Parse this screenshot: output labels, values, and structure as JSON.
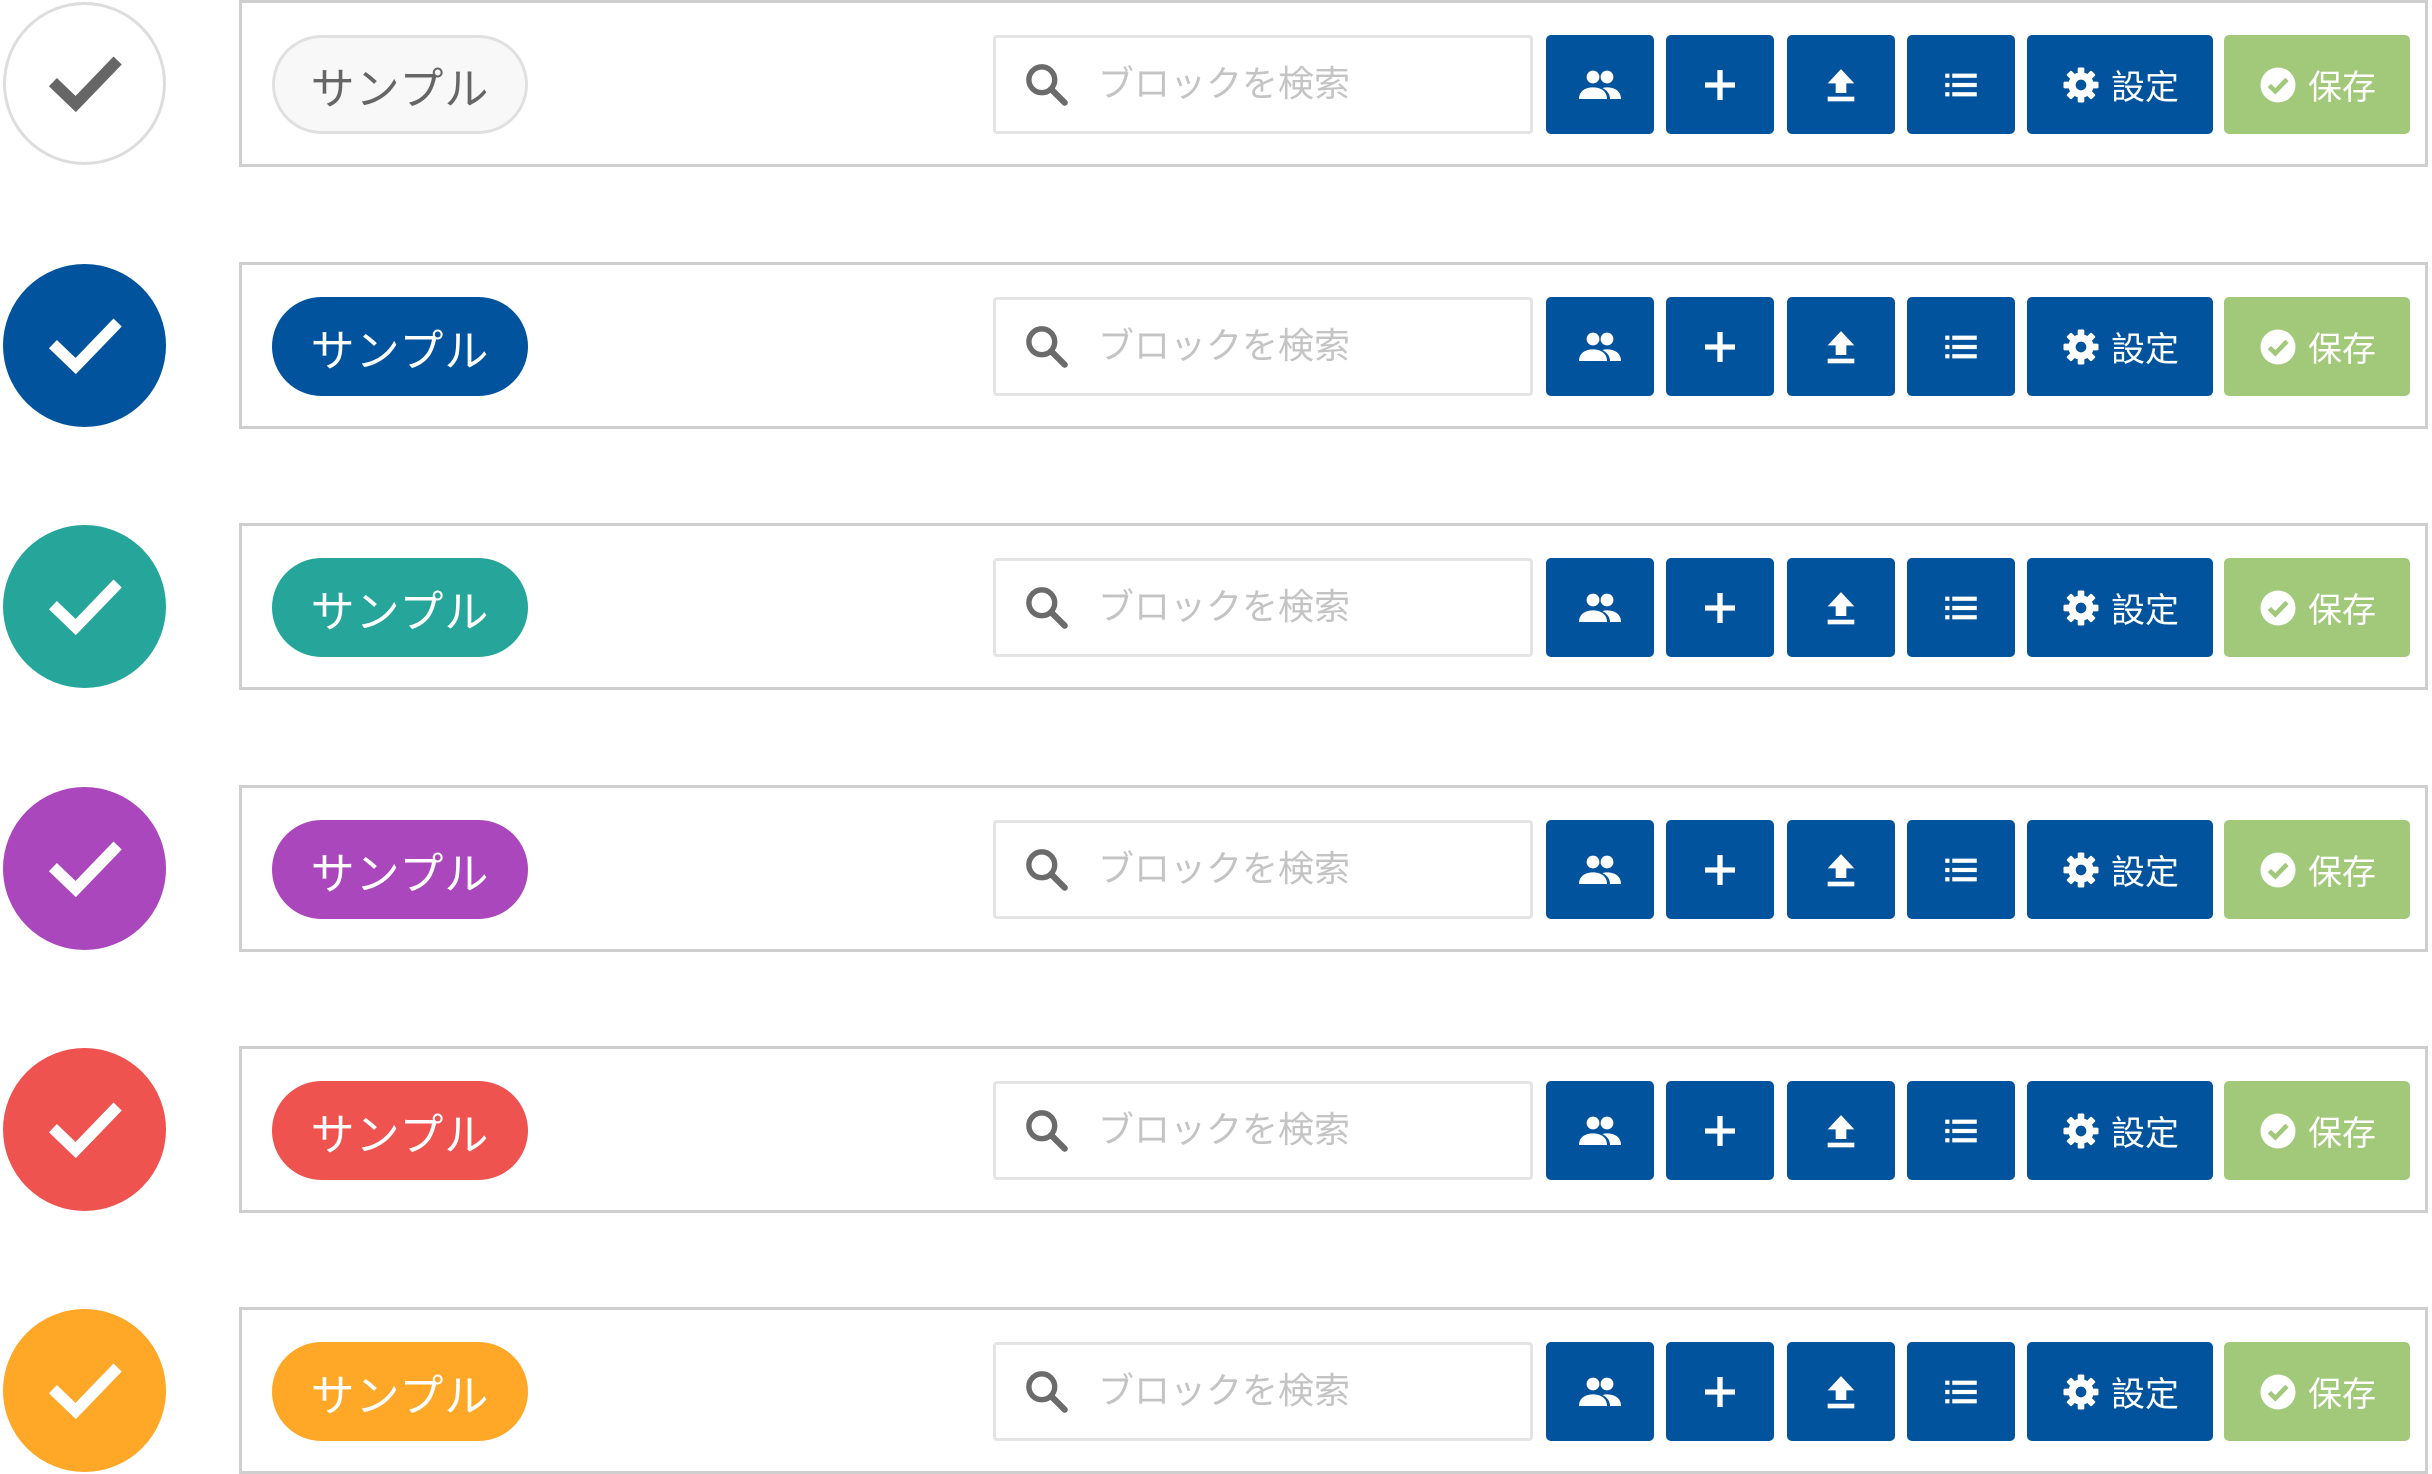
{
  "rows": [
    {
      "check_bg": "#ffffff",
      "check_border": "#dddddd",
      "check_mark": "#666666",
      "pill_label": "サンプル",
      "pill_bg": "#f8f8f8",
      "pill_border": "#e0e0e0",
      "pill_text": "#666666",
      "search_placeholder": "ブロックを検索",
      "settings_label": "設定",
      "save_label": "保存"
    },
    {
      "check_bg": "#00539c",
      "check_border": "#00539c",
      "check_mark": "#ffffff",
      "pill_label": "サンプル",
      "pill_bg": "#00539c",
      "pill_border": "#00539c",
      "pill_text": "#ffffff",
      "search_placeholder": "ブロックを検索",
      "settings_label": "設定",
      "save_label": "保存"
    },
    {
      "check_bg": "#26a69a",
      "check_border": "#26a69a",
      "check_mark": "#ffffff",
      "pill_label": "サンプル",
      "pill_bg": "#26a69a",
      "pill_border": "#26a69a",
      "pill_text": "#ffffff",
      "search_placeholder": "ブロックを検索",
      "settings_label": "設定",
      "save_label": "保存"
    },
    {
      "check_bg": "#ab47bc",
      "check_border": "#ab47bc",
      "check_mark": "#ffffff",
      "pill_label": "サンプル",
      "pill_bg": "#ab47bc",
      "pill_border": "#ab47bc",
      "pill_text": "#ffffff",
      "search_placeholder": "ブロックを検索",
      "settings_label": "設定",
      "save_label": "保存"
    },
    {
      "check_bg": "#ef5350",
      "check_border": "#ef5350",
      "check_mark": "#ffffff",
      "pill_label": "サンプル",
      "pill_bg": "#ef5350",
      "pill_border": "#ef5350",
      "pill_text": "#ffffff",
      "search_placeholder": "ブロックを検索",
      "settings_label": "設定",
      "save_label": "保存"
    },
    {
      "check_bg": "#ffa726",
      "check_border": "#ffa726",
      "check_mark": "#ffffff",
      "pill_label": "サンプル",
      "pill_bg": "#ffa726",
      "pill_border": "#ffa726",
      "pill_text": "#ffffff",
      "search_placeholder": "ブロックを検索",
      "settings_label": "設定",
      "save_label": "保存"
    }
  ],
  "icons": {
    "check": "check-icon",
    "search": "search-icon",
    "users": "users-icon",
    "add": "plus-icon",
    "upload": "upload-icon",
    "list": "list-icon",
    "settings": "gear-icon",
    "save": "check-circle-icon"
  },
  "colors": {
    "action_blue": "#00539c",
    "save_green": "#a2c97a",
    "toolbar_border": "#cfcfcf"
  }
}
